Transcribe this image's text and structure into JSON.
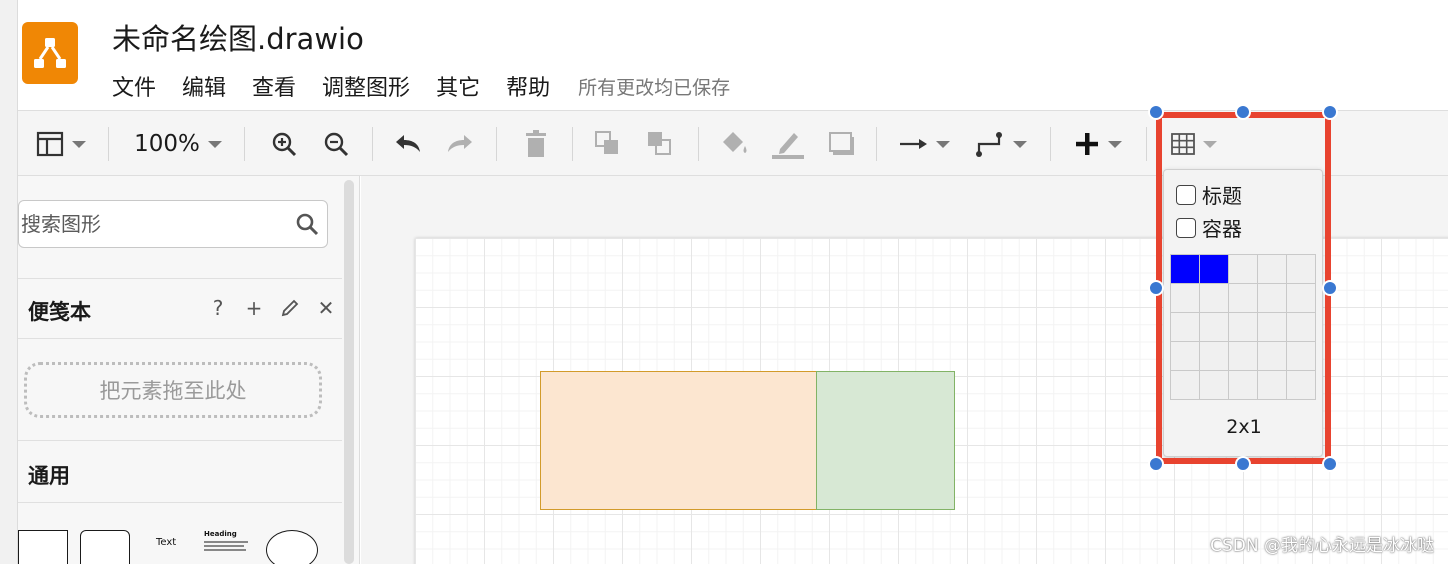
{
  "app": {
    "title": "未命名绘图.drawio",
    "save_status": "所有更改均已保存"
  },
  "menu": [
    {
      "label": "文件"
    },
    {
      "label": "编辑"
    },
    {
      "label": "查看"
    },
    {
      "label": "调整图形"
    },
    {
      "label": "其它"
    },
    {
      "label": "帮助"
    }
  ],
  "toolbar": {
    "zoom": "100%",
    "icons": [
      "format-panel-icon",
      "zoom-in-icon",
      "zoom-out-icon",
      "undo-icon",
      "redo-icon",
      "delete-icon",
      "to-front-icon",
      "to-back-icon",
      "fill-color-icon",
      "line-color-icon",
      "shadow-icon",
      "connection-icon",
      "waypoints-icon",
      "insert-plus-icon",
      "table-icon"
    ]
  },
  "sidebar": {
    "search_placeholder": "搜索图形",
    "scratchpad": {
      "title": "便笺本",
      "help": "?",
      "add": "+",
      "close": "✕",
      "dropzone": "把元素拖至此处"
    },
    "general": {
      "title": "通用",
      "samples": [
        "Text",
        "Heading"
      ]
    }
  },
  "canvas": {
    "shapes": [
      {
        "name": "left-cell",
        "fill": "#fce6d0",
        "stroke": "#d29b2a"
      },
      {
        "name": "right-cell",
        "fill": "#d7e8d4",
        "stroke": "#82b366"
      }
    ]
  },
  "table_popup": {
    "option_header": "标题",
    "option_container": "容器",
    "grid_rows": 5,
    "grid_cols": 5,
    "selected_cols": 2,
    "selected_rows": 1,
    "size_label": "2x1"
  },
  "colors": {
    "logo": "#f08705",
    "highlight": "#e8432f",
    "handle": "#3a78d1",
    "selected_cell": "#0000ff"
  },
  "watermark": "CSDN @我的心永远是冰冰哒"
}
